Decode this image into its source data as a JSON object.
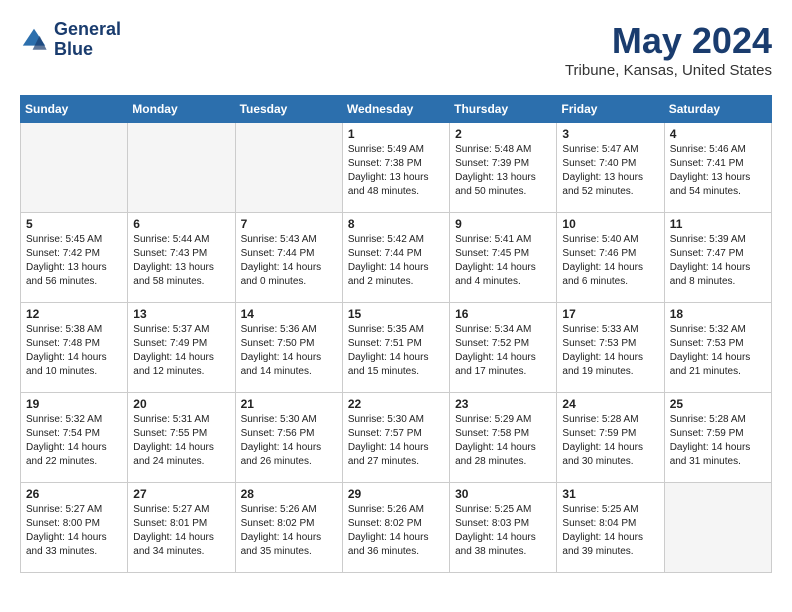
{
  "header": {
    "logo_line1": "General",
    "logo_line2": "Blue",
    "month": "May 2024",
    "location": "Tribune, Kansas, United States"
  },
  "weekdays": [
    "Sunday",
    "Monday",
    "Tuesday",
    "Wednesday",
    "Thursday",
    "Friday",
    "Saturday"
  ],
  "weeks": [
    [
      {
        "day": "",
        "info": "",
        "empty": true
      },
      {
        "day": "",
        "info": "",
        "empty": true
      },
      {
        "day": "",
        "info": "",
        "empty": true
      },
      {
        "day": "1",
        "info": "Sunrise: 5:49 AM\nSunset: 7:38 PM\nDaylight: 13 hours\nand 48 minutes.",
        "empty": false
      },
      {
        "day": "2",
        "info": "Sunrise: 5:48 AM\nSunset: 7:39 PM\nDaylight: 13 hours\nand 50 minutes.",
        "empty": false
      },
      {
        "day": "3",
        "info": "Sunrise: 5:47 AM\nSunset: 7:40 PM\nDaylight: 13 hours\nand 52 minutes.",
        "empty": false
      },
      {
        "day": "4",
        "info": "Sunrise: 5:46 AM\nSunset: 7:41 PM\nDaylight: 13 hours\nand 54 minutes.",
        "empty": false
      }
    ],
    [
      {
        "day": "5",
        "info": "Sunrise: 5:45 AM\nSunset: 7:42 PM\nDaylight: 13 hours\nand 56 minutes.",
        "empty": false
      },
      {
        "day": "6",
        "info": "Sunrise: 5:44 AM\nSunset: 7:43 PM\nDaylight: 13 hours\nand 58 minutes.",
        "empty": false
      },
      {
        "day": "7",
        "info": "Sunrise: 5:43 AM\nSunset: 7:44 PM\nDaylight: 14 hours\nand 0 minutes.",
        "empty": false
      },
      {
        "day": "8",
        "info": "Sunrise: 5:42 AM\nSunset: 7:44 PM\nDaylight: 14 hours\nand 2 minutes.",
        "empty": false
      },
      {
        "day": "9",
        "info": "Sunrise: 5:41 AM\nSunset: 7:45 PM\nDaylight: 14 hours\nand 4 minutes.",
        "empty": false
      },
      {
        "day": "10",
        "info": "Sunrise: 5:40 AM\nSunset: 7:46 PM\nDaylight: 14 hours\nand 6 minutes.",
        "empty": false
      },
      {
        "day": "11",
        "info": "Sunrise: 5:39 AM\nSunset: 7:47 PM\nDaylight: 14 hours\nand 8 minutes.",
        "empty": false
      }
    ],
    [
      {
        "day": "12",
        "info": "Sunrise: 5:38 AM\nSunset: 7:48 PM\nDaylight: 14 hours\nand 10 minutes.",
        "empty": false
      },
      {
        "day": "13",
        "info": "Sunrise: 5:37 AM\nSunset: 7:49 PM\nDaylight: 14 hours\nand 12 minutes.",
        "empty": false
      },
      {
        "day": "14",
        "info": "Sunrise: 5:36 AM\nSunset: 7:50 PM\nDaylight: 14 hours\nand 14 minutes.",
        "empty": false
      },
      {
        "day": "15",
        "info": "Sunrise: 5:35 AM\nSunset: 7:51 PM\nDaylight: 14 hours\nand 15 minutes.",
        "empty": false
      },
      {
        "day": "16",
        "info": "Sunrise: 5:34 AM\nSunset: 7:52 PM\nDaylight: 14 hours\nand 17 minutes.",
        "empty": false
      },
      {
        "day": "17",
        "info": "Sunrise: 5:33 AM\nSunset: 7:53 PM\nDaylight: 14 hours\nand 19 minutes.",
        "empty": false
      },
      {
        "day": "18",
        "info": "Sunrise: 5:32 AM\nSunset: 7:53 PM\nDaylight: 14 hours\nand 21 minutes.",
        "empty": false
      }
    ],
    [
      {
        "day": "19",
        "info": "Sunrise: 5:32 AM\nSunset: 7:54 PM\nDaylight: 14 hours\nand 22 minutes.",
        "empty": false
      },
      {
        "day": "20",
        "info": "Sunrise: 5:31 AM\nSunset: 7:55 PM\nDaylight: 14 hours\nand 24 minutes.",
        "empty": false
      },
      {
        "day": "21",
        "info": "Sunrise: 5:30 AM\nSunset: 7:56 PM\nDaylight: 14 hours\nand 26 minutes.",
        "empty": false
      },
      {
        "day": "22",
        "info": "Sunrise: 5:30 AM\nSunset: 7:57 PM\nDaylight: 14 hours\nand 27 minutes.",
        "empty": false
      },
      {
        "day": "23",
        "info": "Sunrise: 5:29 AM\nSunset: 7:58 PM\nDaylight: 14 hours\nand 28 minutes.",
        "empty": false
      },
      {
        "day": "24",
        "info": "Sunrise: 5:28 AM\nSunset: 7:59 PM\nDaylight: 14 hours\nand 30 minutes.",
        "empty": false
      },
      {
        "day": "25",
        "info": "Sunrise: 5:28 AM\nSunset: 7:59 PM\nDaylight: 14 hours\nand 31 minutes.",
        "empty": false
      }
    ],
    [
      {
        "day": "26",
        "info": "Sunrise: 5:27 AM\nSunset: 8:00 PM\nDaylight: 14 hours\nand 33 minutes.",
        "empty": false
      },
      {
        "day": "27",
        "info": "Sunrise: 5:27 AM\nSunset: 8:01 PM\nDaylight: 14 hours\nand 34 minutes.",
        "empty": false
      },
      {
        "day": "28",
        "info": "Sunrise: 5:26 AM\nSunset: 8:02 PM\nDaylight: 14 hours\nand 35 minutes.",
        "empty": false
      },
      {
        "day": "29",
        "info": "Sunrise: 5:26 AM\nSunset: 8:02 PM\nDaylight: 14 hours\nand 36 minutes.",
        "empty": false
      },
      {
        "day": "30",
        "info": "Sunrise: 5:25 AM\nSunset: 8:03 PM\nDaylight: 14 hours\nand 38 minutes.",
        "empty": false
      },
      {
        "day": "31",
        "info": "Sunrise: 5:25 AM\nSunset: 8:04 PM\nDaylight: 14 hours\nand 39 minutes.",
        "empty": false
      },
      {
        "day": "",
        "info": "",
        "empty": true
      }
    ]
  ]
}
